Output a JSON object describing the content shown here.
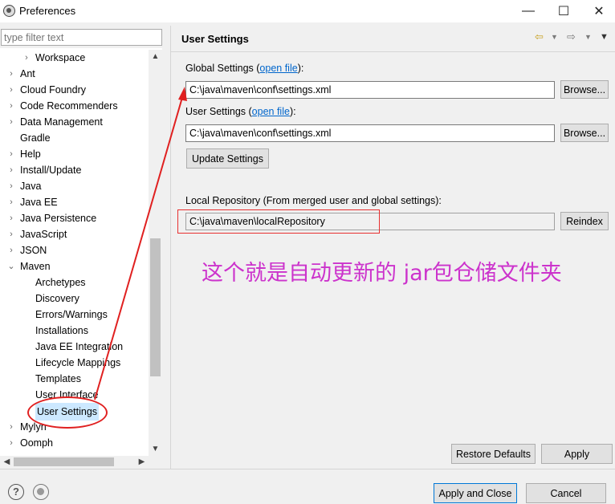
{
  "window": {
    "title": "Preferences",
    "minimize": "—",
    "maximize": "☐",
    "close": "✕"
  },
  "filter": {
    "placeholder": "type filter text"
  },
  "tree": [
    {
      "label": "Workspace",
      "arrow": "›"
    },
    {
      "label": "Ant",
      "arrow": "›"
    },
    {
      "label": "Cloud Foundry",
      "arrow": "›"
    },
    {
      "label": "Code Recommenders",
      "arrow": "›"
    },
    {
      "label": "Data Management",
      "arrow": "›"
    },
    {
      "label": "Gradle",
      "arrow": ""
    },
    {
      "label": "Help",
      "arrow": "›"
    },
    {
      "label": "Install/Update",
      "arrow": "›"
    },
    {
      "label": "Java",
      "arrow": "›"
    },
    {
      "label": "Java EE",
      "arrow": "›"
    },
    {
      "label": "Java Persistence",
      "arrow": "›"
    },
    {
      "label": "JavaScript",
      "arrow": "›"
    },
    {
      "label": "JSON",
      "arrow": "›"
    },
    {
      "label": "Maven",
      "arrow": "⌄"
    },
    {
      "label": "Archetypes",
      "arrow": ""
    },
    {
      "label": "Discovery",
      "arrow": ""
    },
    {
      "label": "Errors/Warnings",
      "arrow": ""
    },
    {
      "label": "Installations",
      "arrow": ""
    },
    {
      "label": "Java EE Integration",
      "arrow": ""
    },
    {
      "label": "Lifecycle Mappings",
      "arrow": ""
    },
    {
      "label": "Templates",
      "arrow": ""
    },
    {
      "label": "User Interface",
      "arrow": ""
    },
    {
      "label": "User Settings",
      "arrow": ""
    },
    {
      "label": "Mylyn",
      "arrow": "›"
    },
    {
      "label": "Oomph",
      "arrow": "›"
    }
  ],
  "page": {
    "title": "User Settings",
    "global_label_prefix": "Global Settings (",
    "global_link": "open file",
    "global_label_suffix": "):",
    "global_value": "C:\\java\\maven\\conf\\settings.xml",
    "browse": "Browse...",
    "user_label_prefix": "User Settings (",
    "user_link": "open file",
    "user_label_suffix": "):",
    "user_value": "C:\\java\\maven\\conf\\settings.xml",
    "update_settings": "Update Settings",
    "local_repo_label": "Local Repository (From merged user and global settings):",
    "local_repo_value": "C:\\java\\maven\\localRepository",
    "reindex": "Reindex",
    "annotation": "这个就是自动更新的 jar包仓储文件夹",
    "restore_defaults": "Restore Defaults",
    "apply": "Apply"
  },
  "footer": {
    "apply_close": "Apply and Close",
    "cancel": "Cancel",
    "help_glyph": "?"
  },
  "colors": {
    "annotation": "#cc33cc",
    "highlight_red": "#e02020",
    "link": "#0066cc",
    "selection": "#cce8ff"
  }
}
